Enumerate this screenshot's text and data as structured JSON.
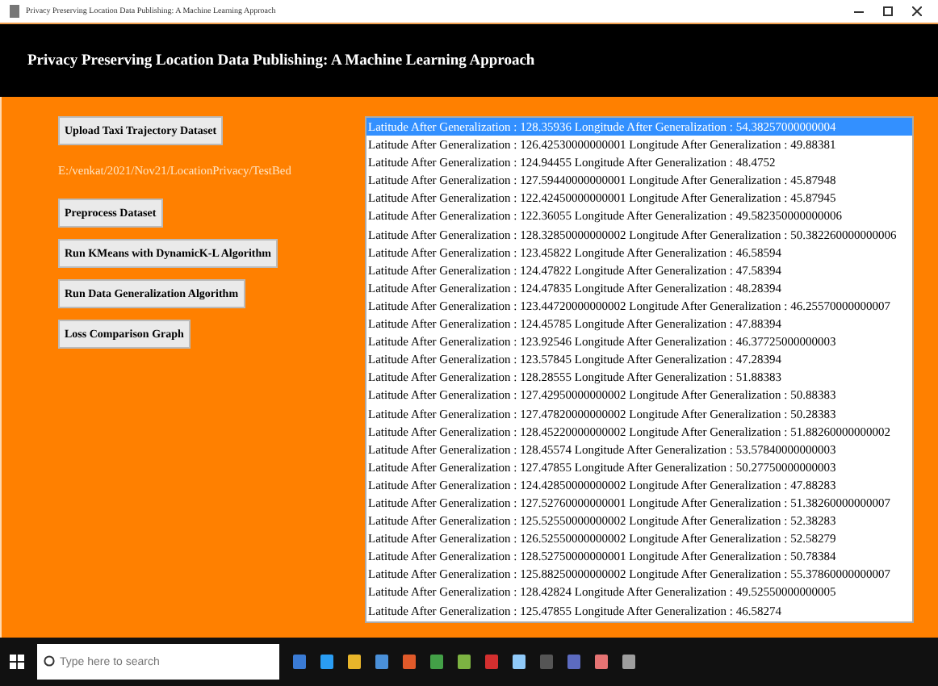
{
  "window": {
    "title": "Privacy Preserving Location Data Publishing: A Machine Learning Approach"
  },
  "header": {
    "title": "Privacy Preserving Location Data Publishing: A Machine Learning Approach"
  },
  "actions": [
    {
      "kind": "button",
      "label": "Upload Taxi Trajectory Dataset"
    },
    {
      "kind": "path",
      "label": "E:/venkat/2021/Nov21/LocationPrivacy/TestBed"
    },
    {
      "kind": "button",
      "label": "Preprocess Dataset"
    },
    {
      "kind": "button",
      "label": "Run KMeans with DynamicK-L Algorithm"
    },
    {
      "kind": "button",
      "label": "Run Data Generalization Algorithm"
    },
    {
      "kind": "button",
      "label": "Loss Comparison Graph"
    }
  ],
  "results": [
    {
      "text": "Latitude After Generalization : 128.35936 Longitude After Generalization : 54.38257000000004",
      "selected": true
    },
    {
      "text": "Latitude After Generalization : 126.42530000000001 Longitude After Generalization : 49.88381",
      "selected": false
    },
    {
      "text": "Latitude After Generalization : 124.94455 Longitude After Generalization : 48.4752",
      "selected": false
    },
    {
      "text": "Latitude After Generalization : 127.59440000000001 Longitude After Generalization : 45.87948",
      "selected": false
    },
    {
      "text": "Latitude After Generalization : 122.42450000000001 Longitude After Generalization : 45.87945",
      "selected": false
    },
    {
      "text": "Latitude After Generalization : 122.36055 Longitude After Generalization : 49.582350000000006",
      "selected": false
    },
    {
      "text": "Latitude After Generalization : 128.32850000000002 Longitude After Generalization : 50.382260000000006",
      "selected": false
    },
    {
      "text": "Latitude After Generalization : 123.45822 Longitude After Generalization : 46.58594",
      "selected": false
    },
    {
      "text": "Latitude After Generalization : 124.47822 Longitude After Generalization : 47.58394",
      "selected": false
    },
    {
      "text": "Latitude After Generalization : 124.47835 Longitude After Generalization : 48.28394",
      "selected": false
    },
    {
      "text": "Latitude After Generalization : 123.44720000000002 Longitude After Generalization : 46.25570000000007",
      "selected": false
    },
    {
      "text": "Latitude After Generalization : 124.45785 Longitude After Generalization : 47.88394",
      "selected": false
    },
    {
      "text": "Latitude After Generalization : 123.92546 Longitude After Generalization : 46.37725000000003",
      "selected": false
    },
    {
      "text": "Latitude After Generalization : 123.57845 Longitude After Generalization : 47.28394",
      "selected": false
    },
    {
      "text": "Latitude After Generalization : 128.28555 Longitude After Generalization : 51.88383",
      "selected": false
    },
    {
      "text": "Latitude After Generalization : 127.42950000000002 Longitude After Generalization : 50.88383",
      "selected": false
    },
    {
      "text": "Latitude After Generalization : 127.47820000000002 Longitude After Generalization : 50.28383",
      "selected": false
    },
    {
      "text": "Latitude After Generalization : 128.45220000000002 Longitude After Generalization : 51.88260000000002",
      "selected": false
    },
    {
      "text": "Latitude After Generalization : 128.45574 Longitude After Generalization : 53.57840000000003",
      "selected": false
    },
    {
      "text": "Latitude After Generalization : 127.47855 Longitude After Generalization : 50.27750000000003",
      "selected": false
    },
    {
      "text": "Latitude After Generalization : 124.42850000000002 Longitude After Generalization : 47.88283",
      "selected": false
    },
    {
      "text": "Latitude After Generalization : 127.52760000000001 Longitude After Generalization : 51.38260000000007",
      "selected": false
    },
    {
      "text": "Latitude After Generalization : 125.52550000000002 Longitude After Generalization : 52.38283",
      "selected": false
    },
    {
      "text": "Latitude After Generalization : 126.52550000000002 Longitude After Generalization : 52.58279",
      "selected": false
    },
    {
      "text": "Latitude After Generalization : 128.52750000000001 Longitude After Generalization : 50.78384",
      "selected": false
    },
    {
      "text": "Latitude After Generalization : 125.88250000000002 Longitude After Generalization : 55.37860000000007",
      "selected": false
    },
    {
      "text": "Latitude After Generalization : 128.42824 Longitude After Generalization : 49.52550000000005",
      "selected": false
    },
    {
      "text": "Latitude After Generalization : 125.47855 Longitude After Generalization : 46.58274",
      "selected": false
    }
  ],
  "taskbar": {
    "search": {
      "placeholder": "Type here to search"
    }
  }
}
